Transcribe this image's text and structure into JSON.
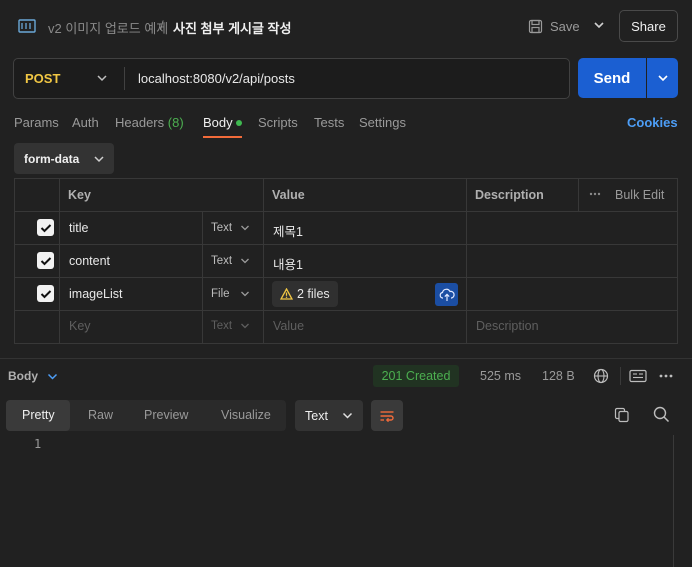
{
  "header": {
    "parent": "v2 이미지 업로드 예제",
    "separator": "/",
    "title": "사진 첨부 게시글 작성",
    "save_label": "Save",
    "share_label": "Share"
  },
  "request": {
    "method": "POST",
    "url": "localhost:8080/v2/api/posts",
    "send_label": "Send"
  },
  "tabs": {
    "params": "Params",
    "auth": "Auth",
    "headers": "Headers",
    "headers_count": "(8)",
    "body": "Body",
    "scripts": "Scripts",
    "tests": "Tests",
    "settings": "Settings",
    "cookies": "Cookies"
  },
  "body_type": "form-data",
  "table": {
    "headers": {
      "key": "Key",
      "value": "Value",
      "description": "Description",
      "bulk_edit": "Bulk Edit"
    },
    "rows": [
      {
        "key": "title",
        "type": "Text",
        "value": "제목1",
        "checked": true
      },
      {
        "key": "content",
        "type": "Text",
        "value": "내용1",
        "checked": true
      },
      {
        "key": "imageList",
        "type": "File",
        "value": "2 files",
        "checked": true
      }
    ],
    "placeholder": {
      "key": "Key",
      "type": "Text",
      "value": "Value",
      "description": "Description"
    }
  },
  "response": {
    "label": "Body",
    "status": "201 Created",
    "time": "525 ms",
    "size": "128 B",
    "views": [
      "Pretty",
      "Raw",
      "Preview",
      "Visualize"
    ],
    "format": "Text",
    "line_number": "1"
  },
  "colors": {
    "accent": "#1b5fd2",
    "method": "#f1c744",
    "status_ok": "#4caf50",
    "tab_underline": "#f26b3a",
    "link": "#4d9ef7"
  }
}
